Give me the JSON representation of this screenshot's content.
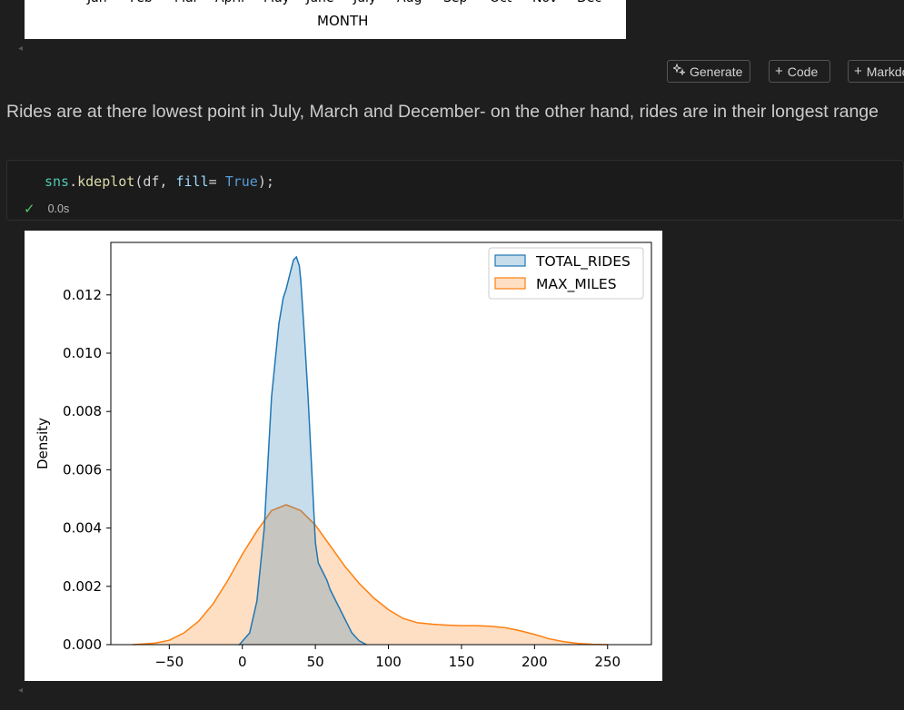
{
  "prev_output": {
    "months": [
      "Jan",
      "Feb",
      "Mar",
      "April",
      "May",
      "June",
      "July",
      "Aug",
      "Sep",
      "Oct",
      "Nov",
      "Dec"
    ],
    "xlabel": "MONTH"
  },
  "toolbar": {
    "generate_label": "Generate",
    "code_label": "Code",
    "markdown_label": "Markdown"
  },
  "markdown": {
    "text": "Rides are at there lowest point in July, March and December- on the other hand, rides are in their longest range"
  },
  "cell": {
    "code": {
      "module": "sns",
      "dot": ".",
      "func": "kdeplot",
      "open": "(",
      "arg": "df, ",
      "kw": "fill",
      "eq": "= ",
      "bool": "True",
      "close": ");"
    },
    "status": {
      "duration": "0.0s"
    }
  },
  "chart_data": {
    "type": "area",
    "title": "",
    "xlabel": "",
    "ylabel": "Density",
    "xlim": [
      -90,
      280
    ],
    "ylim": [
      0,
      0.0138
    ],
    "xticks": [
      -50,
      0,
      50,
      100,
      150,
      200,
      250
    ],
    "yticks": [
      0.0,
      0.002,
      0.004,
      0.006,
      0.008,
      0.01,
      0.012
    ],
    "ytick_labels": [
      "0.000",
      "0.002",
      "0.004",
      "0.006",
      "0.008",
      "0.010",
      "0.012"
    ],
    "legend": "upper-right",
    "series": [
      {
        "name": "TOTAL_RIDES",
        "color": "#1f77b4",
        "x": [
          -2,
          5,
          10,
          15,
          20,
          25,
          28,
          30,
          33,
          35,
          37,
          39,
          40,
          42,
          45,
          48,
          50,
          52,
          55,
          58,
          60,
          63,
          65,
          70,
          75,
          80,
          85
        ],
        "y": [
          0.0,
          0.0004,
          0.0015,
          0.004,
          0.0085,
          0.011,
          0.0119,
          0.0122,
          0.0128,
          0.0132,
          0.0133,
          0.013,
          0.0125,
          0.011,
          0.0085,
          0.0055,
          0.0035,
          0.0028,
          0.0025,
          0.0022,
          0.0019,
          0.0016,
          0.0014,
          0.0009,
          0.0004,
          0.00013,
          0.0
        ]
      },
      {
        "name": "MAX_MILES",
        "color": "#ff7f0e",
        "x": [
          -75,
          -60,
          -50,
          -40,
          -30,
          -20,
          -10,
          0,
          10,
          20,
          30,
          40,
          50,
          60,
          70,
          80,
          90,
          100,
          110,
          120,
          130,
          140,
          150,
          160,
          170,
          180,
          190,
          200,
          210,
          220,
          230,
          240,
          250
        ],
        "y": [
          0.0,
          5e-05,
          0.00015,
          0.0004,
          0.0008,
          0.0014,
          0.0022,
          0.0031,
          0.0039,
          0.0046,
          0.0048,
          0.0046,
          0.0041,
          0.0034,
          0.0027,
          0.0021,
          0.0016,
          0.0012,
          0.0009,
          0.00075,
          0.0007,
          0.00067,
          0.00065,
          0.00065,
          0.00063,
          0.00058,
          0.00048,
          0.00035,
          0.0002,
          0.0001,
          4e-05,
          1e-05,
          0.0
        ]
      }
    ]
  }
}
